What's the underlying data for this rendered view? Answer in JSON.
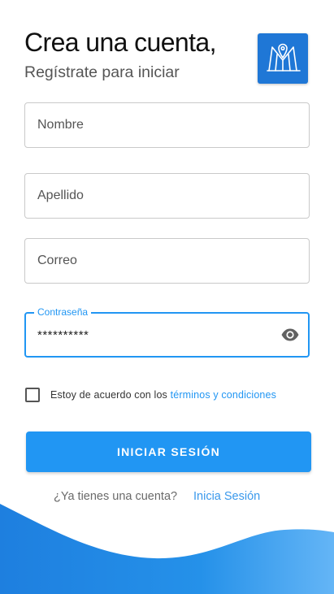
{
  "header": {
    "title": "Crea una cuenta,",
    "subtitle": "Regístrate para iniciar",
    "logo_icon": "map-pin-m-logo-icon"
  },
  "form": {
    "nombre_placeholder": "Nombre",
    "apellido_placeholder": "Apellido",
    "correo_placeholder": "Correo",
    "password_label": "Contraseña",
    "password_value": "**********",
    "password_toggle_icon": "eye-icon"
  },
  "terms": {
    "checked": false,
    "prefix": "Estoy de acuerdo con los ",
    "link": "términos y condiciones"
  },
  "actions": {
    "submit_label": "INICIAR SESIÓN",
    "have_account_text": "¿Ya tienes una cuenta?",
    "login_link": "Inicia Sesión"
  },
  "colors": {
    "primary": "#2196f3",
    "logo_bg": "#1f77d6",
    "wave_dark": "#1e7fdf",
    "wave_light": "#64b5f6"
  }
}
